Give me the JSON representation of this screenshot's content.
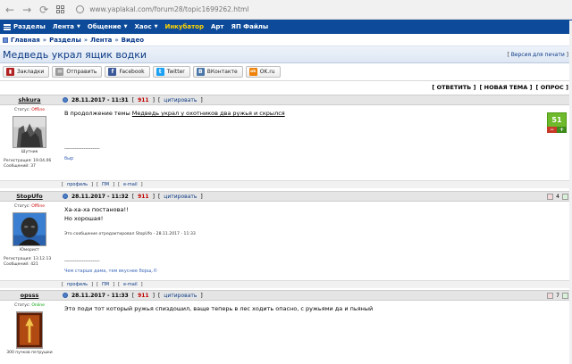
{
  "browser": {
    "url": "www.yaplakal.com/forum28/topic1699262.html"
  },
  "nav": {
    "items": [
      {
        "label": "Разделы",
        "icon": "menu-icon",
        "yellow": false,
        "caret": false
      },
      {
        "label": "Лента",
        "caret": true,
        "yellow": false
      },
      {
        "label": "Общение",
        "caret": true,
        "yellow": false
      },
      {
        "label": "Хаос",
        "caret": true,
        "yellow": false
      },
      {
        "label": "Инкубатор",
        "caret": false,
        "yellow": true
      },
      {
        "label": "Арт",
        "caret": false,
        "yellow": false
      },
      {
        "label": "ЯП Файлы",
        "caret": false,
        "yellow": false
      }
    ]
  },
  "breadcrumb": {
    "items": [
      "Главная",
      "Разделы",
      "Лента",
      "Видео"
    ],
    "sep": "»"
  },
  "topic": {
    "title": "Медведь украл ящик водки",
    "print_label": "Версия для печати"
  },
  "share": [
    {
      "label": "Закладки",
      "icon": "bookmark-icon",
      "color": "#b22222",
      "glyph": "▮"
    },
    {
      "label": "Отправить",
      "icon": "mail-icon",
      "color": "#999999",
      "glyph": "✉"
    },
    {
      "label": "Facebook",
      "icon": "facebook-icon",
      "color": "#3b5998",
      "glyph": "f"
    },
    {
      "label": "Twitter",
      "icon": "twitter-icon",
      "color": "#1da1f2",
      "glyph": "t"
    },
    {
      "label": "ВКонтакте",
      "icon": "vk-icon",
      "color": "#4a76a8",
      "glyph": "В"
    },
    {
      "label": "OK.ru",
      "icon": "ok-icon",
      "color": "#ee8208",
      "glyph": "ok"
    }
  ],
  "actions": [
    "[ ОТВЕТИТЬ ]",
    "[ НОВАЯ ТЕМА ]",
    "[ ОПРОС ]"
  ],
  "labels": {
    "status": "Статус:",
    "reg": "Регистрация:",
    "msgs": "Сообщений:",
    "cite": "цитировать",
    "profile": "профиль",
    "pm": "ПМ",
    "email": "e-mail"
  },
  "posts": [
    {
      "user": "shkura",
      "online": false,
      "status_text": "Offline",
      "user_title": "Шутник",
      "reg": "19.04.06",
      "msgs": "37",
      "date": "28.11.2017 - 11:31",
      "num": "911",
      "text_prefix": "В продолжение темы ",
      "text_link": "Медведь украл у охотников два ружья и скрылся",
      "signature_line": "--------------------",
      "signature": "быр",
      "rating": {
        "value": "51",
        "minus": "−",
        "plus": "+"
      }
    },
    {
      "user": "StopUfo",
      "online": false,
      "status_text": "Offline",
      "user_title": "Юморист",
      "reg": "13.12.13",
      "msgs": "421",
      "date": "28.11.2017 - 11:32",
      "num": "911",
      "lines": [
        "Ха-ха-ха постанова!!",
        "Но хорошая!"
      ],
      "edited": "Это сообщение отредактировал StopUfo - 28.11.2017 - 11:33",
      "signature_line": "--------------------",
      "signature": "Чем старше дама, тем вкуснее борщ.©",
      "head_rating": "4"
    },
    {
      "user": "opsss",
      "online": true,
      "status_text": "Online",
      "user_title": "300 пучков петрушки",
      "date": "28.11.2017 - 11:33",
      "num": "911",
      "text": "Это поди тот который ружья спиздошил, ваще теперь в лес ходить опасно, с ружьями да и пьяный",
      "head_rating": "7"
    }
  ]
}
